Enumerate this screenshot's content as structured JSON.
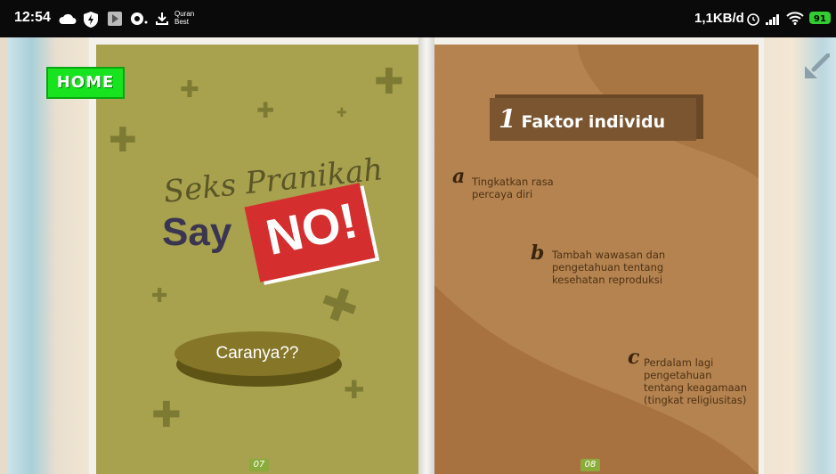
{
  "status_bar": {
    "time": "12:54",
    "app_label_line1": "Quran",
    "app_label_line2": "Best",
    "net_speed": "1,1KB/d",
    "battery": "91",
    "icons": [
      "cloud-icon",
      "shield-bolt-icon",
      "play-store-icon",
      "chat-icon",
      "download-icon",
      "alarm-icon",
      "signal-icon",
      "wifi-icon",
      "battery-icon"
    ]
  },
  "home_button": "HOME",
  "left_page": {
    "title_line1": "Seks Pranikah",
    "title_say": "Say",
    "title_no": "NO!",
    "button": "Caranya??",
    "page_number": "07"
  },
  "right_page": {
    "heading_number": "1",
    "heading": "Faktor individu",
    "items": [
      {
        "letter": "a",
        "text": [
          "Tingkatkan rasa",
          "percaya diri"
        ]
      },
      {
        "letter": "b",
        "text": [
          "Tambah wawasan dan",
          "pengetahuan tentang",
          "kesehatan reproduksi"
        ]
      },
      {
        "letter": "c",
        "text": [
          "Perdalam lagi",
          "pengetahuan",
          "tentang keagamaan",
          "(tingkat religiusitas)"
        ]
      }
    ],
    "page_number": "08"
  },
  "colors": {
    "left_page_bg": "#a8a14e",
    "right_page_bg": "#b5834f",
    "home_green": "#17e41e",
    "no_red": "#d42e2e"
  }
}
